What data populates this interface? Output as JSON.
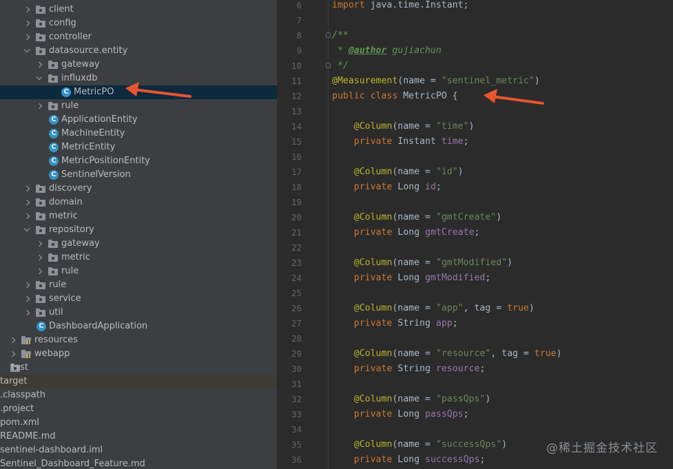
{
  "tree": [
    {
      "depth": 2,
      "kind": "folder",
      "chev": "right",
      "label": "client"
    },
    {
      "depth": 2,
      "kind": "folder",
      "chev": "right",
      "label": "config"
    },
    {
      "depth": 2,
      "kind": "folder",
      "chev": "right",
      "label": "controller"
    },
    {
      "depth": 2,
      "kind": "folder",
      "chev": "down",
      "label": "datasource.entity"
    },
    {
      "depth": 3,
      "kind": "folder",
      "chev": "right",
      "label": "gateway"
    },
    {
      "depth": 3,
      "kind": "folder",
      "chev": "down",
      "label": "influxdb"
    },
    {
      "depth": 4,
      "kind": "class",
      "chev": "",
      "label": "MetricPO",
      "selected": true
    },
    {
      "depth": 3,
      "kind": "folder",
      "chev": "right",
      "label": "rule"
    },
    {
      "depth": 3,
      "kind": "class",
      "chev": "",
      "label": "ApplicationEntity"
    },
    {
      "depth": 3,
      "kind": "class",
      "chev": "",
      "label": "MachineEntity"
    },
    {
      "depth": 3,
      "kind": "class",
      "chev": "",
      "label": "MetricEntity"
    },
    {
      "depth": 3,
      "kind": "class",
      "chev": "",
      "label": "MetricPositionEntity"
    },
    {
      "depth": 3,
      "kind": "class",
      "chev": "",
      "label": "SentinelVersion"
    },
    {
      "depth": 2,
      "kind": "folder",
      "chev": "right",
      "label": "discovery"
    },
    {
      "depth": 2,
      "kind": "folder",
      "chev": "right",
      "label": "domain"
    },
    {
      "depth": 2,
      "kind": "folder",
      "chev": "right",
      "label": "metric"
    },
    {
      "depth": 2,
      "kind": "folder",
      "chev": "down",
      "label": "repository"
    },
    {
      "depth": 3,
      "kind": "folder",
      "chev": "right",
      "label": "gateway"
    },
    {
      "depth": 3,
      "kind": "folder",
      "chev": "right",
      "label": "metric"
    },
    {
      "depth": 3,
      "kind": "folder",
      "chev": "right",
      "label": "rule"
    },
    {
      "depth": 2,
      "kind": "folder",
      "chev": "right",
      "label": "rule"
    },
    {
      "depth": 2,
      "kind": "folder",
      "chev": "right",
      "label": "service"
    },
    {
      "depth": 2,
      "kind": "folder",
      "chev": "right",
      "label": "util"
    },
    {
      "depth": 2,
      "kind": "class",
      "chev": "",
      "label": "DashboardApplication"
    },
    {
      "depth": 1,
      "kind": "res",
      "chev": "right",
      "label": "resources"
    },
    {
      "depth": 1,
      "kind": "res",
      "chev": "right",
      "label": "webapp"
    },
    {
      "depth": 0,
      "kind": "folder",
      "chev": "",
      "label": "test"
    },
    {
      "depth": -1,
      "kind": "none",
      "chev": "",
      "label": "target",
      "target": true
    },
    {
      "depth": -1,
      "kind": "none",
      "chev": "",
      "label": ".classpath"
    },
    {
      "depth": -1,
      "kind": "none",
      "chev": "",
      "label": ".project"
    },
    {
      "depth": -1,
      "kind": "none",
      "chev": "",
      "label": "pom.xml"
    },
    {
      "depth": -1,
      "kind": "none",
      "chev": "",
      "label": "README.md"
    },
    {
      "depth": -1,
      "kind": "none",
      "chev": "",
      "label": "sentinel-dashboard.iml"
    },
    {
      "depth": -1,
      "kind": "none",
      "chev": "",
      "label": "Sentinel_Dashboard_Feature.md"
    }
  ],
  "editor": {
    "lines": [
      {
        "n": "6",
        "tokens": [
          [
            "kw",
            "import "
          ],
          [
            "typ",
            "java.time.Instant;"
          ]
        ]
      },
      {
        "n": "7",
        "tokens": []
      },
      {
        "n": "8",
        "tokens": [
          [
            "cmt",
            "/**"
          ]
        ],
        "fold": true
      },
      {
        "n": "9",
        "tokens": [
          [
            "cmt",
            " * "
          ],
          [
            "tag",
            "@author"
          ],
          [
            "cmt",
            " gujiachun"
          ]
        ]
      },
      {
        "n": "10",
        "tokens": [
          [
            "cmt",
            " */"
          ]
        ],
        "fold": true
      },
      {
        "n": "11",
        "tokens": [
          [
            "ann",
            "@Measurement"
          ],
          [
            "typ",
            "(name = "
          ],
          [
            "str",
            "\"sentinel_metric\""
          ],
          [
            "typ",
            ")"
          ]
        ]
      },
      {
        "n": "12",
        "tokens": [
          [
            "kw",
            "public class "
          ],
          [
            "typ",
            "MetricPO {"
          ]
        ]
      },
      {
        "n": "13",
        "tokens": []
      },
      {
        "n": "14",
        "tokens": [
          [
            "typ",
            "    "
          ],
          [
            "ann",
            "@Column"
          ],
          [
            "typ",
            "(name = "
          ],
          [
            "str",
            "\"time\""
          ],
          [
            "typ",
            ")"
          ]
        ]
      },
      {
        "n": "15",
        "tokens": [
          [
            "typ",
            "    "
          ],
          [
            "kw",
            "private "
          ],
          [
            "typ",
            "Instant "
          ],
          [
            "fld",
            "time"
          ],
          [
            "typ",
            ";"
          ]
        ]
      },
      {
        "n": "16",
        "tokens": []
      },
      {
        "n": "17",
        "tokens": [
          [
            "typ",
            "    "
          ],
          [
            "ann",
            "@Column"
          ],
          [
            "typ",
            "(name = "
          ],
          [
            "str",
            "\"id\""
          ],
          [
            "typ",
            ")"
          ]
        ]
      },
      {
        "n": "18",
        "tokens": [
          [
            "typ",
            "    "
          ],
          [
            "kw",
            "private "
          ],
          [
            "typ",
            "Long "
          ],
          [
            "fld",
            "id"
          ],
          [
            "typ",
            ";"
          ]
        ]
      },
      {
        "n": "19",
        "tokens": []
      },
      {
        "n": "20",
        "tokens": [
          [
            "typ",
            "    "
          ],
          [
            "ann",
            "@Column"
          ],
          [
            "typ",
            "(name = "
          ],
          [
            "str",
            "\"gmtCreate\""
          ],
          [
            "typ",
            ")"
          ]
        ]
      },
      {
        "n": "21",
        "tokens": [
          [
            "typ",
            "    "
          ],
          [
            "kw",
            "private "
          ],
          [
            "typ",
            "Long "
          ],
          [
            "fld",
            "gmtCreate"
          ],
          [
            "typ",
            ";"
          ]
        ]
      },
      {
        "n": "22",
        "tokens": []
      },
      {
        "n": "23",
        "tokens": [
          [
            "typ",
            "    "
          ],
          [
            "ann",
            "@Column"
          ],
          [
            "typ",
            "(name = "
          ],
          [
            "str",
            "\"gmtModified\""
          ],
          [
            "typ",
            ")"
          ]
        ]
      },
      {
        "n": "24",
        "tokens": [
          [
            "typ",
            "    "
          ],
          [
            "kw",
            "private "
          ],
          [
            "typ",
            "Long "
          ],
          [
            "fld",
            "gmtModified"
          ],
          [
            "typ",
            ";"
          ]
        ]
      },
      {
        "n": "25",
        "tokens": []
      },
      {
        "n": "26",
        "tokens": [
          [
            "typ",
            "    "
          ],
          [
            "ann",
            "@Column"
          ],
          [
            "typ",
            "(name = "
          ],
          [
            "str",
            "\"app\""
          ],
          [
            "typ",
            ", tag = "
          ],
          [
            "kw",
            "true"
          ],
          [
            "typ",
            ")"
          ]
        ]
      },
      {
        "n": "27",
        "tokens": [
          [
            "typ",
            "    "
          ],
          [
            "kw",
            "private "
          ],
          [
            "typ",
            "String "
          ],
          [
            "fld",
            "app"
          ],
          [
            "typ",
            ";"
          ]
        ]
      },
      {
        "n": "28",
        "tokens": []
      },
      {
        "n": "29",
        "tokens": [
          [
            "typ",
            "    "
          ],
          [
            "ann",
            "@Column"
          ],
          [
            "typ",
            "(name = "
          ],
          [
            "str",
            "\"resource\""
          ],
          [
            "typ",
            ", tag = "
          ],
          [
            "kw",
            "true"
          ],
          [
            "typ",
            ")"
          ]
        ]
      },
      {
        "n": "30",
        "tokens": [
          [
            "typ",
            "    "
          ],
          [
            "kw",
            "private "
          ],
          [
            "typ",
            "String "
          ],
          [
            "fld",
            "resource"
          ],
          [
            "typ",
            ";"
          ]
        ]
      },
      {
        "n": "31",
        "tokens": []
      },
      {
        "n": "32",
        "tokens": [
          [
            "typ",
            "    "
          ],
          [
            "ann",
            "@Column"
          ],
          [
            "typ",
            "(name = "
          ],
          [
            "str",
            "\"passQps\""
          ],
          [
            "typ",
            ")"
          ]
        ]
      },
      {
        "n": "33",
        "tokens": [
          [
            "typ",
            "    "
          ],
          [
            "kw",
            "private "
          ],
          [
            "typ",
            "Long "
          ],
          [
            "fld",
            "passQps"
          ],
          [
            "typ",
            ";"
          ]
        ]
      },
      {
        "n": "34",
        "tokens": []
      },
      {
        "n": "35",
        "tokens": [
          [
            "typ",
            "    "
          ],
          [
            "ann",
            "@Column"
          ],
          [
            "typ",
            "(name = "
          ],
          [
            "str",
            "\"successQps\""
          ],
          [
            "typ",
            ")"
          ]
        ]
      },
      {
        "n": "36",
        "tokens": [
          [
            "typ",
            "    "
          ],
          [
            "kw",
            "private "
          ],
          [
            "typ",
            "Long "
          ],
          [
            "fld",
            "successQps"
          ],
          [
            "typ",
            ";"
          ]
        ]
      }
    ]
  },
  "watermark": "@稀土掘金技术社区",
  "colors": {
    "arrow": "#e8552f",
    "selection": "#0d293e",
    "class_icon": "#3592c4"
  }
}
